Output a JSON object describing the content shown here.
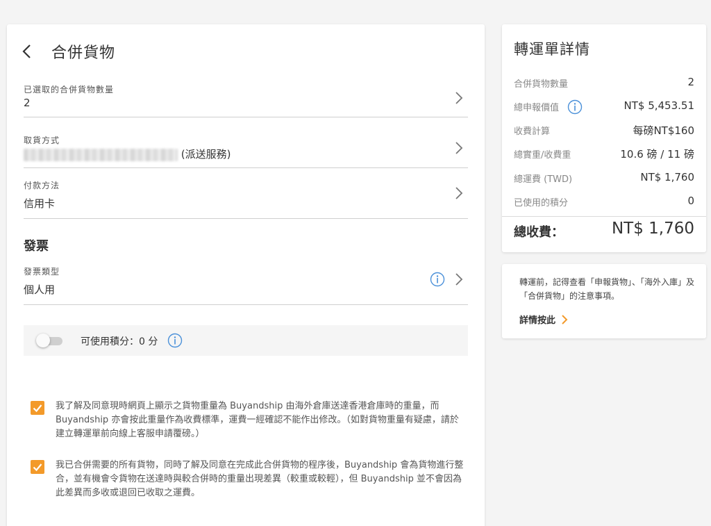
{
  "header": {
    "title": "合併貨物"
  },
  "rows": {
    "quantity": {
      "label": "已選取的合併貨物數量",
      "value": "2"
    },
    "pickup": {
      "label": "取貨方式",
      "value": "(派送服務)"
    },
    "payment": {
      "label": "付款方法",
      "value": "信用卡"
    },
    "invoice": {
      "label": "發票類型",
      "value": "個人用"
    }
  },
  "invoice_section": {
    "title": "發票"
  },
  "points": {
    "label": "可使用積分：0 分",
    "enabled": false
  },
  "consents": [
    {
      "checked": true,
      "text": "我了解及同意現時網頁上顯示之貨物重量為 Buyandship 由海外倉庫送達香港倉庫時的重量，而 Buyandship 亦會按此重量作為收費標準，運費一經確認不能作出修改。（如對貨物重量有疑慮，請於建立轉運單前向線上客服申請覆磅。）"
    },
    {
      "checked": true,
      "text": "我已合併需要的所有貨物，同時了解及同意在完成此合併貨物的程序後，Buyandship 會為貨物進行整合，並有機會令貨物在送達時與較合併時的重量出現差異（較重或較輕），但 Buyandship 並不會因為此差異而多收或退回已收取之運費。"
    }
  ],
  "summary": {
    "title": "轉運單詳情",
    "items": [
      {
        "label": "合併貨物數量",
        "value": "2"
      },
      {
        "label": "總申報價值",
        "value": "NT$ 5,453.51"
      },
      {
        "label": "收費計算",
        "value": "每磅NT$160"
      },
      {
        "label": "總實重/收費重",
        "value": "10.6 磅 / 11 磅"
      },
      {
        "label": "總運費 (TWD)",
        "value": "NT$ 1,760"
      },
      {
        "label": "已使用的積分",
        "value": "0"
      }
    ],
    "total_label": "總收費：",
    "total_value": "NT$ 1,760"
  },
  "note": {
    "text": "轉運前，記得查看「申報貨物」、「海外入庫」及「合併貨物」的注意事項。",
    "link_label": "詳情按此"
  },
  "colors": {
    "accent": "#f39a2a",
    "info": "#4a90d9",
    "background": "#f4f4f4"
  },
  "icons": [
    "back-icon",
    "chevron-right-icon",
    "info-icon",
    "check-icon"
  ]
}
